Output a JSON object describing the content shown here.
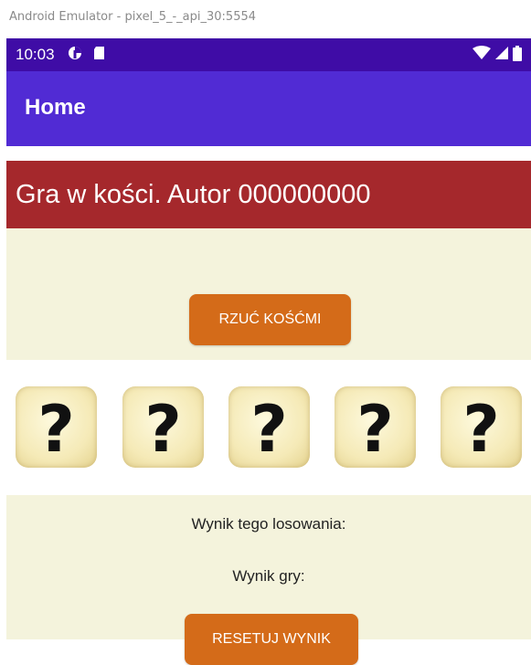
{
  "window": {
    "title": "Android Emulator - pixel_5_-_api_30:5554"
  },
  "status_bar": {
    "time": "10:03",
    "left_icons": [
      "data-saver-icon",
      "sd-card-icon"
    ],
    "right_icons": [
      "wifi-icon",
      "signal-icon",
      "battery-icon"
    ]
  },
  "app_bar": {
    "title": "Home"
  },
  "header": {
    "text": "Gra w kości. Autor 000000000"
  },
  "actions": {
    "roll_label": "RZUĆ KOŚĆMI",
    "reset_label": "RESETUJ WYNIK"
  },
  "dice": [
    {
      "face": "?"
    },
    {
      "face": "?"
    },
    {
      "face": "?"
    },
    {
      "face": "?"
    },
    {
      "face": "?"
    }
  ],
  "results": {
    "roll_result_label": "Wynik tego losowania:",
    "game_result_label": "Wynik gry:"
  },
  "colors": {
    "status_bar": "#3f0ca6",
    "app_bar": "#512bd4",
    "header": "#a5282c",
    "panel": "#f4f3dc",
    "button": "#d46b19"
  }
}
